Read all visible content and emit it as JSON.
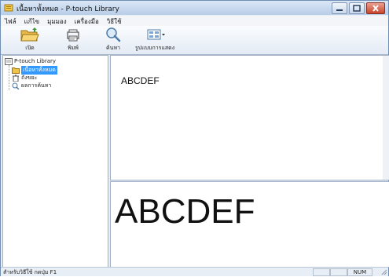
{
  "window": {
    "title": "เนื้อหาทั้งหมด - P-touch Library"
  },
  "menu": [
    {
      "label": "ไฟล์"
    },
    {
      "label": "แก้ไข"
    },
    {
      "label": "มุมมอง"
    },
    {
      "label": "เครื่องมือ"
    },
    {
      "label": "วิธีใช้"
    }
  ],
  "toolbar": {
    "open_label": "เปิด",
    "print_label": "พิมพ์",
    "search_label": "ค้นหา",
    "view_label": "รูปแบบการแสดง"
  },
  "tree": {
    "root": "P-touch Library",
    "items": [
      {
        "label": "เนื้อหาทั้งหมด",
        "selected": true
      },
      {
        "label": "ถังขยะ",
        "selected": false
      },
      {
        "label": "ผลการค้นหา",
        "selected": false
      }
    ]
  },
  "preview": {
    "list_text": "ABCDEF",
    "large_text": "ABCDEF"
  },
  "status": {
    "help_text": "สำหรับวิธีใช้ กดปุ่ม F1",
    "num": "NUM"
  },
  "colors": {
    "selection": "#3399ff",
    "titlebar": "#b8cde8"
  }
}
